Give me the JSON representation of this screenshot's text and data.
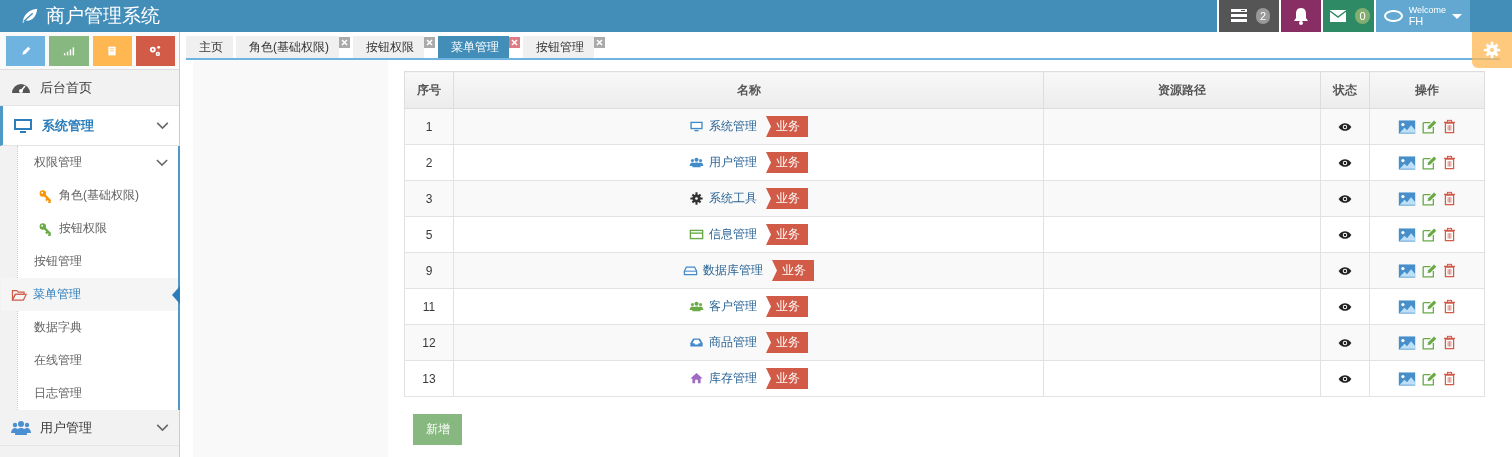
{
  "header": {
    "title": "商户管理系统",
    "nav": [
      {
        "kind": "tasks",
        "badge": "2"
      },
      {
        "kind": "notifications"
      },
      {
        "kind": "messages",
        "badge": "0"
      }
    ],
    "user": {
      "greeting": "Welcome",
      "name": "FH"
    }
  },
  "shortcuts": [
    {
      "kind": "pencil",
      "color": "#6fb3e0"
    },
    {
      "kind": "signal",
      "color": "#87b87f"
    },
    {
      "kind": "book",
      "color": "#ffb752"
    },
    {
      "kind": "cogs",
      "color": "#d15b47"
    }
  ],
  "sidebar": {
    "items": [
      {
        "label": "后台首页",
        "kind": "dashboard",
        "selected": false
      },
      {
        "label": "系统管理",
        "kind": "desktop",
        "selected": false,
        "expanded": true,
        "children": [
          {
            "label": "权限管理",
            "selected": false,
            "expanded": true,
            "children": [
              {
                "label": "角色(基础权限)",
                "kind": "key",
                "color": "#f89406",
                "selected": false
              },
              {
                "label": "按钮权限",
                "kind": "key",
                "color": "#69aa46",
                "selected": false
              }
            ]
          },
          {
            "label": "按钮管理",
            "selected": false
          },
          {
            "label": "菜单管理",
            "selected": true
          },
          {
            "label": "数据字典",
            "selected": false
          },
          {
            "label": "在线管理",
            "selected": false
          },
          {
            "label": "日志管理",
            "selected": false
          }
        ]
      },
      {
        "label": "用户管理",
        "kind": "users",
        "selected": false,
        "expanded": false
      }
    ]
  },
  "tabs": [
    {
      "label": "主页",
      "selected": false,
      "closable": false
    },
    {
      "label": "角色(基础权限)",
      "selected": false,
      "closable": true
    },
    {
      "label": "按钮权限",
      "selected": false,
      "closable": true
    },
    {
      "label": "菜单管理",
      "selected": true,
      "closable": true
    },
    {
      "label": "按钮管理",
      "selected": false,
      "closable": true
    }
  ],
  "table": {
    "columns": [
      "序号",
      "名称",
      "资源路径",
      "状态",
      "操作"
    ],
    "rows": [
      {
        "index": "1",
        "name": "系统管理",
        "kind": "desktop",
        "color": "#428bca",
        "tag": "业务",
        "visible": true
      },
      {
        "index": "2",
        "name": "用户管理",
        "kind": "users",
        "color": "#428bca",
        "tag": "业务",
        "visible": true
      },
      {
        "index": "3",
        "name": "系统工具",
        "kind": "cog",
        "color": "#333333",
        "tag": "业务",
        "visible": true
      },
      {
        "index": "5",
        "name": "信息管理",
        "kind": "card",
        "color": "#69aa46",
        "tag": "业务",
        "visible": true
      },
      {
        "index": "9",
        "name": "数据库管理",
        "kind": "hdd",
        "color": "#428bca",
        "tag": "业务",
        "visible": true
      },
      {
        "index": "11",
        "name": "客户管理",
        "kind": "users",
        "color": "#69aa46",
        "tag": "业务",
        "visible": true
      },
      {
        "index": "12",
        "name": "商品管理",
        "kind": "inbox",
        "color": "#428bca",
        "tag": "业务",
        "visible": true
      },
      {
        "index": "13",
        "name": "库存管理",
        "kind": "home",
        "color": "#a069c3",
        "tag": "业务",
        "visible": true
      }
    ]
  },
  "add_button": "新增"
}
